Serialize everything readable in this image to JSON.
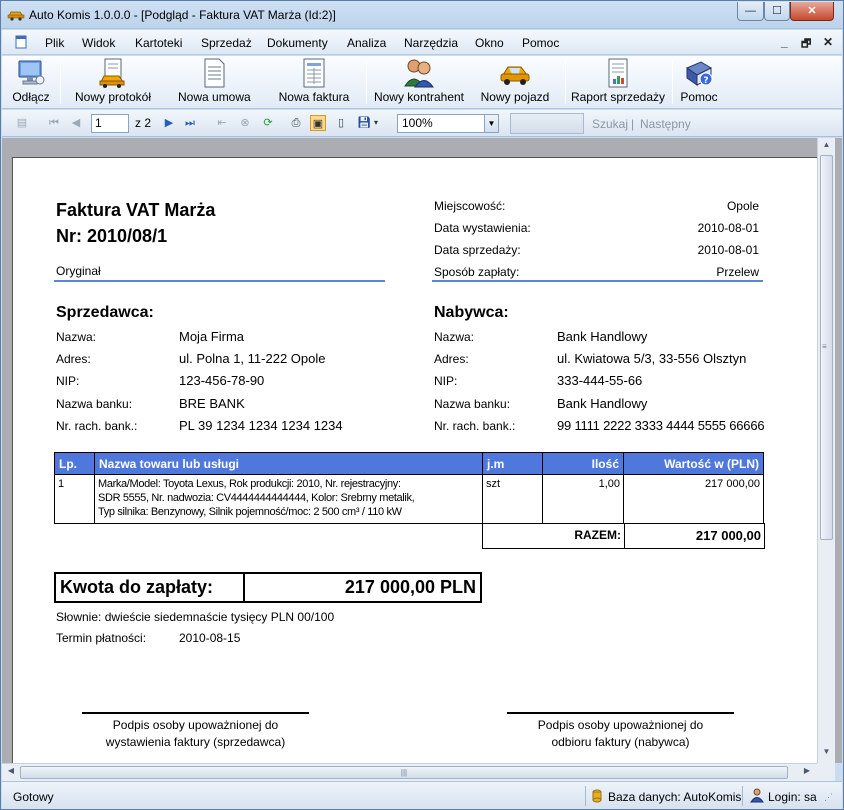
{
  "window": {
    "title": "Auto Komis 1.0.0.0 - [Podgląd - Faktura VAT Marża (Id:2)]",
    "min": "—",
    "max": "☐",
    "close": "✕"
  },
  "menu": {
    "items": [
      "Plik",
      "Widok",
      "Kartoteki",
      "Sprzedaż",
      "Dokumenty",
      "Analiza",
      "Narzędzia",
      "Okno",
      "Pomoc"
    ],
    "mdi_min": "_",
    "mdi_restore": "🗗",
    "mdi_close": "✕"
  },
  "toolbar": {
    "buttons": [
      "Odłącz",
      "Nowy protokół",
      "Nowa umowa",
      "Nowa faktura",
      "Nowy kontrahent",
      "Nowy pojazd",
      "Raport sprzedaży",
      "Pomoc"
    ]
  },
  "preview_nav": {
    "page_value": "1",
    "page_of": "z 2",
    "zoom": "100%",
    "search_label": "Szukaj",
    "next_label": "Następny",
    "separator": "|"
  },
  "invoice": {
    "title": "Faktura VAT Marża",
    "number": "Nr: 2010/08/1",
    "copy_type": "Oryginał",
    "meta": [
      {
        "label": "Miejscowość:",
        "value": "Opole"
      },
      {
        "label": "Data wystawienia:",
        "value": "2010-08-01"
      },
      {
        "label": "Data sprzedaży:",
        "value": "2010-08-01"
      },
      {
        "label": "Sposób zapłaty:",
        "value": "Przelew"
      }
    ],
    "seller": {
      "heading": "Sprzedawca:",
      "rows": [
        {
          "label": "Nazwa:",
          "value": "Moja Firma"
        },
        {
          "label": "Adres:",
          "value": "ul. Polna 1, 11-222 Opole"
        },
        {
          "label": "NIP:",
          "value": "123-456-78-90"
        },
        {
          "label": "Nazwa banku:",
          "value": "BRE BANK"
        },
        {
          "label": "Nr. rach. bank.:",
          "value": "PL 39 1234 1234 1234 1234"
        }
      ]
    },
    "buyer": {
      "heading": "Nabywca:",
      "rows": [
        {
          "label": "Nazwa:",
          "value": "Bank Handlowy"
        },
        {
          "label": "Adres:",
          "value": "ul. Kwiatowa 5/3, 33-556 Olsztyn"
        },
        {
          "label": "NIP:",
          "value": "333-444-55-66"
        },
        {
          "label": "Nazwa banku:",
          "value": "Bank Handlowy"
        },
        {
          "label": "Nr. rach. bank.:",
          "value": "99 1111 2222 3333 4444 5555 66666"
        }
      ]
    },
    "table": {
      "headers": [
        "Lp.",
        "Nazwa towaru lub usługi",
        "j.m",
        "Ilość",
        "Wartość w (PLN)"
      ],
      "rows": [
        {
          "lp": "1",
          "desc1": "Marka/Model: Toyota Lexus, Rok produkcji: 2010, Nr. rejestracyjny:",
          "desc2": "SDR 5555, Nr. nadwozia: CV4444444444444, Kolor: Srebrny metalik,",
          "desc3": "Typ silnika: Benzynowy, Silnik pojemność/moc: 2 500 cm³ / 110 kW",
          "jm": "szt",
          "qty": "1,00",
          "value": "217 000,00"
        }
      ],
      "total_label": "RAZEM:",
      "total_value": "217 000,00"
    },
    "amount_label": "Kwota do zapłaty:",
    "amount_value": "217 000,00 PLN",
    "words": "Słownie: dwieście siedemnaście tysięcy PLN 00/100",
    "due_label": "Termin płatności:",
    "due_value": "2010-08-15",
    "sign_left_1": "Podpis osoby upoważnionej do",
    "sign_left_2": "wystawienia faktury (sprzedawca)",
    "sign_right_1": "Podpis osoby upoważnionej do",
    "sign_right_2": "odbioru faktury (nabywca)"
  },
  "status": {
    "ready": "Gotowy",
    "db": "Baza danych: AutoKomis",
    "login": "Login: sa"
  },
  "colors": {
    "table_header": "#4e78dc",
    "accent_line": "#5d85d6",
    "chrome": "#c9dcf0"
  }
}
